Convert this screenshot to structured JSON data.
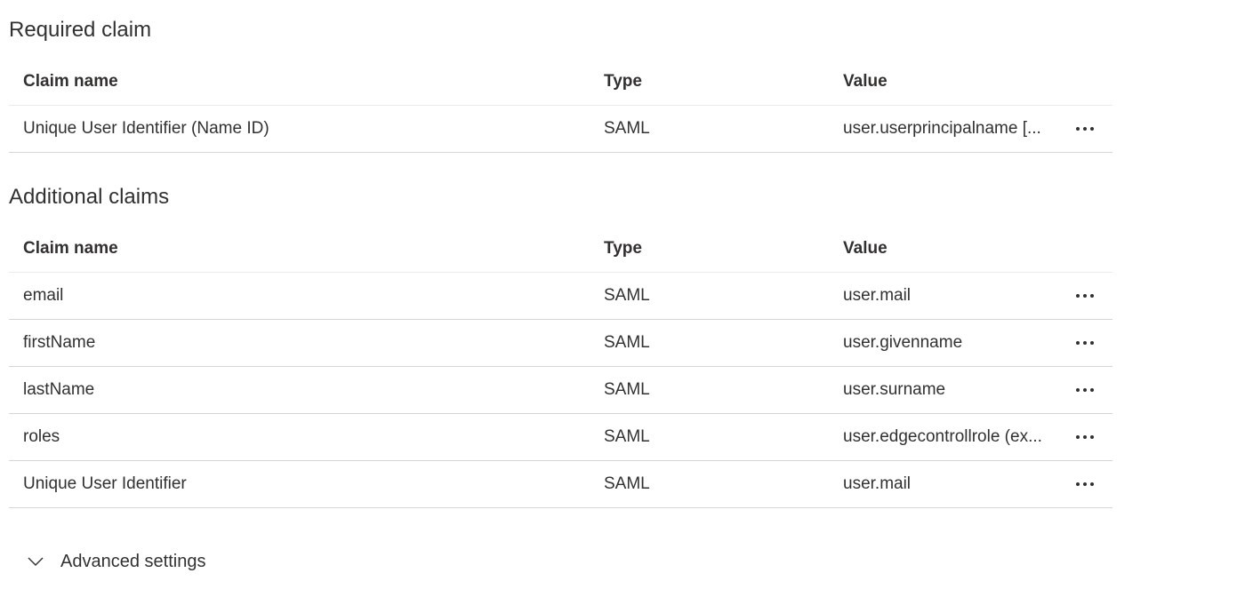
{
  "required": {
    "title": "Required claim",
    "headers": {
      "name": "Claim name",
      "type": "Type",
      "value": "Value"
    },
    "rows": [
      {
        "name": "Unique User Identifier (Name ID)",
        "type": "SAML",
        "value": "user.userprincipalname [..."
      }
    ]
  },
  "additional": {
    "title": "Additional claims",
    "headers": {
      "name": "Claim name",
      "type": "Type",
      "value": "Value"
    },
    "rows": [
      {
        "name": "email",
        "type": "SAML",
        "value": "user.mail"
      },
      {
        "name": "firstName",
        "type": "SAML",
        "value": "user.givenname"
      },
      {
        "name": "lastName",
        "type": "SAML",
        "value": "user.surname"
      },
      {
        "name": "roles",
        "type": "SAML",
        "value": "user.edgecontrollrole (ex..."
      },
      {
        "name": "Unique User Identifier",
        "type": "SAML",
        "value": "user.mail"
      }
    ]
  },
  "advanced": {
    "label": "Advanced settings",
    "icon": "chevron-down-icon"
  },
  "row_menu_icon": "more-options-icon"
}
